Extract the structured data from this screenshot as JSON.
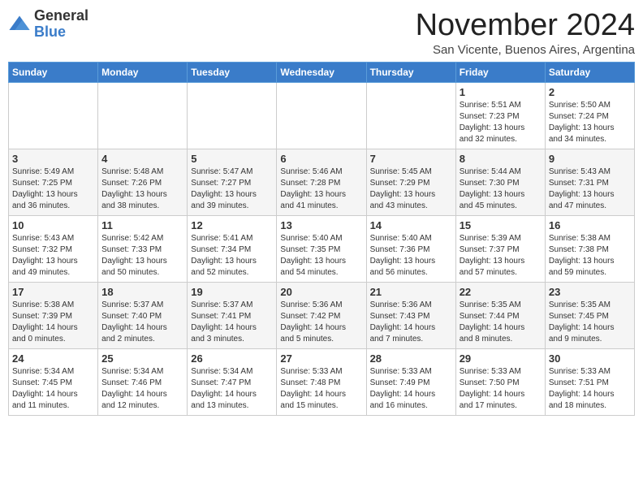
{
  "header": {
    "logo_general": "General",
    "logo_blue": "Blue",
    "month_title": "November 2024",
    "subtitle": "San Vicente, Buenos Aires, Argentina"
  },
  "days_of_week": [
    "Sunday",
    "Monday",
    "Tuesday",
    "Wednesday",
    "Thursday",
    "Friday",
    "Saturday"
  ],
  "weeks": [
    [
      {
        "day": "",
        "info": ""
      },
      {
        "day": "",
        "info": ""
      },
      {
        "day": "",
        "info": ""
      },
      {
        "day": "",
        "info": ""
      },
      {
        "day": "",
        "info": ""
      },
      {
        "day": "1",
        "info": "Sunrise: 5:51 AM\nSunset: 7:23 PM\nDaylight: 13 hours\nand 32 minutes."
      },
      {
        "day": "2",
        "info": "Sunrise: 5:50 AM\nSunset: 7:24 PM\nDaylight: 13 hours\nand 34 minutes."
      }
    ],
    [
      {
        "day": "3",
        "info": "Sunrise: 5:49 AM\nSunset: 7:25 PM\nDaylight: 13 hours\nand 36 minutes."
      },
      {
        "day": "4",
        "info": "Sunrise: 5:48 AM\nSunset: 7:26 PM\nDaylight: 13 hours\nand 38 minutes."
      },
      {
        "day": "5",
        "info": "Sunrise: 5:47 AM\nSunset: 7:27 PM\nDaylight: 13 hours\nand 39 minutes."
      },
      {
        "day": "6",
        "info": "Sunrise: 5:46 AM\nSunset: 7:28 PM\nDaylight: 13 hours\nand 41 minutes."
      },
      {
        "day": "7",
        "info": "Sunrise: 5:45 AM\nSunset: 7:29 PM\nDaylight: 13 hours\nand 43 minutes."
      },
      {
        "day": "8",
        "info": "Sunrise: 5:44 AM\nSunset: 7:30 PM\nDaylight: 13 hours\nand 45 minutes."
      },
      {
        "day": "9",
        "info": "Sunrise: 5:43 AM\nSunset: 7:31 PM\nDaylight: 13 hours\nand 47 minutes."
      }
    ],
    [
      {
        "day": "10",
        "info": "Sunrise: 5:43 AM\nSunset: 7:32 PM\nDaylight: 13 hours\nand 49 minutes."
      },
      {
        "day": "11",
        "info": "Sunrise: 5:42 AM\nSunset: 7:33 PM\nDaylight: 13 hours\nand 50 minutes."
      },
      {
        "day": "12",
        "info": "Sunrise: 5:41 AM\nSunset: 7:34 PM\nDaylight: 13 hours\nand 52 minutes."
      },
      {
        "day": "13",
        "info": "Sunrise: 5:40 AM\nSunset: 7:35 PM\nDaylight: 13 hours\nand 54 minutes."
      },
      {
        "day": "14",
        "info": "Sunrise: 5:40 AM\nSunset: 7:36 PM\nDaylight: 13 hours\nand 56 minutes."
      },
      {
        "day": "15",
        "info": "Sunrise: 5:39 AM\nSunset: 7:37 PM\nDaylight: 13 hours\nand 57 minutes."
      },
      {
        "day": "16",
        "info": "Sunrise: 5:38 AM\nSunset: 7:38 PM\nDaylight: 13 hours\nand 59 minutes."
      }
    ],
    [
      {
        "day": "17",
        "info": "Sunrise: 5:38 AM\nSunset: 7:39 PM\nDaylight: 14 hours\nand 0 minutes."
      },
      {
        "day": "18",
        "info": "Sunrise: 5:37 AM\nSunset: 7:40 PM\nDaylight: 14 hours\nand 2 minutes."
      },
      {
        "day": "19",
        "info": "Sunrise: 5:37 AM\nSunset: 7:41 PM\nDaylight: 14 hours\nand 3 minutes."
      },
      {
        "day": "20",
        "info": "Sunrise: 5:36 AM\nSunset: 7:42 PM\nDaylight: 14 hours\nand 5 minutes."
      },
      {
        "day": "21",
        "info": "Sunrise: 5:36 AM\nSunset: 7:43 PM\nDaylight: 14 hours\nand 7 minutes."
      },
      {
        "day": "22",
        "info": "Sunrise: 5:35 AM\nSunset: 7:44 PM\nDaylight: 14 hours\nand 8 minutes."
      },
      {
        "day": "23",
        "info": "Sunrise: 5:35 AM\nSunset: 7:45 PM\nDaylight: 14 hours\nand 9 minutes."
      }
    ],
    [
      {
        "day": "24",
        "info": "Sunrise: 5:34 AM\nSunset: 7:45 PM\nDaylight: 14 hours\nand 11 minutes."
      },
      {
        "day": "25",
        "info": "Sunrise: 5:34 AM\nSunset: 7:46 PM\nDaylight: 14 hours\nand 12 minutes."
      },
      {
        "day": "26",
        "info": "Sunrise: 5:34 AM\nSunset: 7:47 PM\nDaylight: 14 hours\nand 13 minutes."
      },
      {
        "day": "27",
        "info": "Sunrise: 5:33 AM\nSunset: 7:48 PM\nDaylight: 14 hours\nand 15 minutes."
      },
      {
        "day": "28",
        "info": "Sunrise: 5:33 AM\nSunset: 7:49 PM\nDaylight: 14 hours\nand 16 minutes."
      },
      {
        "day": "29",
        "info": "Sunrise: 5:33 AM\nSunset: 7:50 PM\nDaylight: 14 hours\nand 17 minutes."
      },
      {
        "day": "30",
        "info": "Sunrise: 5:33 AM\nSunset: 7:51 PM\nDaylight: 14 hours\nand 18 minutes."
      }
    ]
  ]
}
